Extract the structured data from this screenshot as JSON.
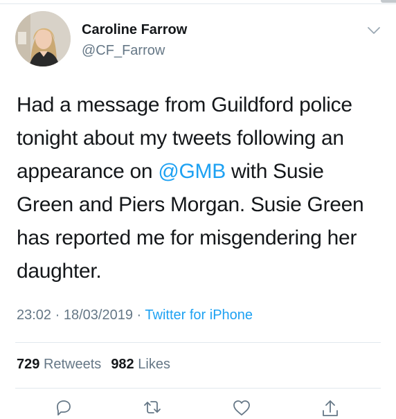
{
  "tweet": {
    "author": {
      "display_name": "Caroline Farrow",
      "handle": "@CF_Farrow"
    },
    "text_parts": [
      "Had a message from Guildford police tonight about my tweets following an appearance on ",
      "@GMB",
      " with Susie Green and Piers Morgan. Susie Green has reported me for misgendering her daughter."
    ],
    "time": "23:02",
    "separator": "·",
    "date": "18/03/2019",
    "source": "Twitter for iPhone",
    "stats": {
      "retweets_count": "729",
      "retweets_label": "Retweets",
      "likes_count": "982",
      "likes_label": "Likes"
    }
  },
  "icons": {
    "more": "chevron-down-icon",
    "reply": "reply-icon",
    "retweet": "retweet-icon",
    "like": "heart-icon",
    "share": "share-icon"
  },
  "colors": {
    "link": "#1da1f2",
    "secondary_text": "#657786",
    "divider": "#e1e8ed"
  }
}
